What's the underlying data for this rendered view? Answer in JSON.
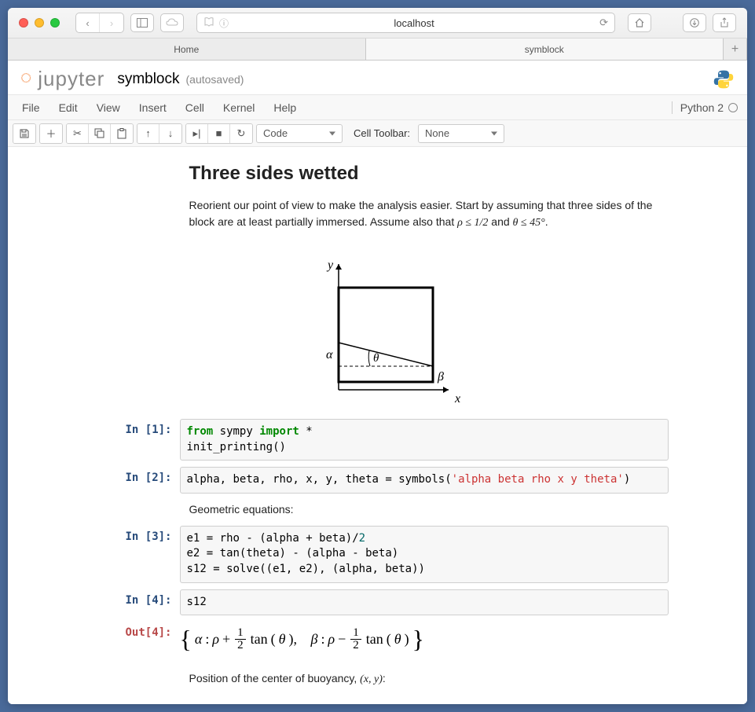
{
  "browser": {
    "url": "localhost",
    "tabs": [
      {
        "label": "Home",
        "active": false
      },
      {
        "label": "symblock",
        "active": true
      }
    ]
  },
  "notebook": {
    "logo_text": "jupyter",
    "name": "symblock",
    "autosave": "(autosaved)",
    "kernel_label": "Python 2",
    "menus": [
      "File",
      "Edit",
      "View",
      "Insert",
      "Cell",
      "Kernel",
      "Help"
    ],
    "cell_type_selector": "Code",
    "cell_toolbar_label": "Cell Toolbar:",
    "cell_toolbar_value": "None"
  },
  "content": {
    "heading": "Three sides wetted",
    "paragraph1_a": "Reorient our point of view to make the analysis easier. Start by assuming that three sides of the block are at least partially immersed. Assume also that ",
    "paragraph1_b": "ρ ≤ 1/2",
    "paragraph1_c": " and ",
    "paragraph1_d": "θ ≤ 45°",
    "paragraph1_e": ".",
    "diagram_labels": {
      "y": "y",
      "x": "x",
      "alpha": "α",
      "beta": "β",
      "theta": "θ"
    },
    "cell2_desc": "Geometric equations:",
    "cell5_desc_a": "Position of the center of buoyancy, ",
    "cell5_desc_b": "(x, y)",
    "cell5_desc_c": ":",
    "output4": {
      "alpha": "α",
      "beta": "β",
      "rho": "ρ",
      "theta": "θ",
      "tan": "tan",
      "half_num": "1",
      "half_den": "2"
    }
  },
  "cells": [
    {
      "prompt": "In [1]:",
      "code_html": "<span class='kw-green'>from</span> sympy <span class='kw-green'>import</span> *\ninit_printing()"
    },
    {
      "prompt": "In [2]:",
      "code_html": "alpha, beta, rho, x, y, theta = symbols(<span class='kw-str'>'alpha beta rho x y theta'</span>)"
    },
    {
      "prompt": "In [3]:",
      "code_html": "e1 = rho - (alpha + beta)/<span class='kw-num'>2</span>\ne2 = tan(theta) - (alpha - beta)\ns12 = solve((e1, e2), (alpha, beta))"
    },
    {
      "prompt": "In [4]:",
      "code_html": "s12"
    }
  ],
  "out_prompt": "Out[4]:"
}
